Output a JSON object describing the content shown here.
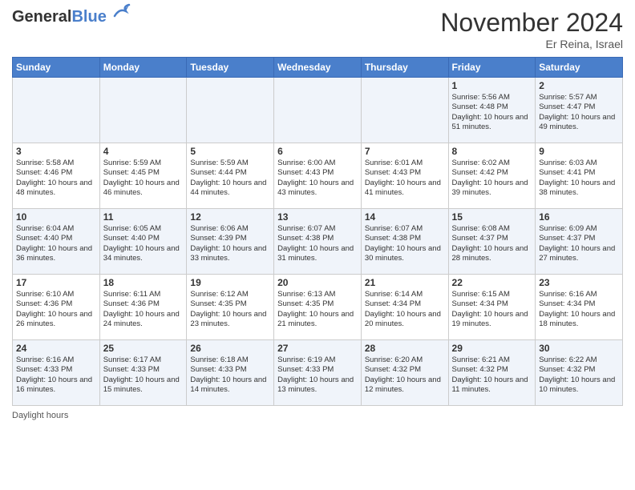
{
  "logo": {
    "general": "General",
    "blue": "Blue"
  },
  "header": {
    "month": "November 2024",
    "location": "Er Reina, Israel"
  },
  "days_of_week": [
    "Sunday",
    "Monday",
    "Tuesday",
    "Wednesday",
    "Thursday",
    "Friday",
    "Saturday"
  ],
  "weeks": [
    [
      {
        "day": "",
        "info": ""
      },
      {
        "day": "",
        "info": ""
      },
      {
        "day": "",
        "info": ""
      },
      {
        "day": "",
        "info": ""
      },
      {
        "day": "",
        "info": ""
      },
      {
        "day": "1",
        "info": "Sunrise: 5:56 AM\nSunset: 4:48 PM\nDaylight: 10 hours and 51 minutes."
      },
      {
        "day": "2",
        "info": "Sunrise: 5:57 AM\nSunset: 4:47 PM\nDaylight: 10 hours and 49 minutes."
      }
    ],
    [
      {
        "day": "3",
        "info": "Sunrise: 5:58 AM\nSunset: 4:46 PM\nDaylight: 10 hours and 48 minutes."
      },
      {
        "day": "4",
        "info": "Sunrise: 5:59 AM\nSunset: 4:45 PM\nDaylight: 10 hours and 46 minutes."
      },
      {
        "day": "5",
        "info": "Sunrise: 5:59 AM\nSunset: 4:44 PM\nDaylight: 10 hours and 44 minutes."
      },
      {
        "day": "6",
        "info": "Sunrise: 6:00 AM\nSunset: 4:43 PM\nDaylight: 10 hours and 43 minutes."
      },
      {
        "day": "7",
        "info": "Sunrise: 6:01 AM\nSunset: 4:43 PM\nDaylight: 10 hours and 41 minutes."
      },
      {
        "day": "8",
        "info": "Sunrise: 6:02 AM\nSunset: 4:42 PM\nDaylight: 10 hours and 39 minutes."
      },
      {
        "day": "9",
        "info": "Sunrise: 6:03 AM\nSunset: 4:41 PM\nDaylight: 10 hours and 38 minutes."
      }
    ],
    [
      {
        "day": "10",
        "info": "Sunrise: 6:04 AM\nSunset: 4:40 PM\nDaylight: 10 hours and 36 minutes."
      },
      {
        "day": "11",
        "info": "Sunrise: 6:05 AM\nSunset: 4:40 PM\nDaylight: 10 hours and 34 minutes."
      },
      {
        "day": "12",
        "info": "Sunrise: 6:06 AM\nSunset: 4:39 PM\nDaylight: 10 hours and 33 minutes."
      },
      {
        "day": "13",
        "info": "Sunrise: 6:07 AM\nSunset: 4:38 PM\nDaylight: 10 hours and 31 minutes."
      },
      {
        "day": "14",
        "info": "Sunrise: 6:07 AM\nSunset: 4:38 PM\nDaylight: 10 hours and 30 minutes."
      },
      {
        "day": "15",
        "info": "Sunrise: 6:08 AM\nSunset: 4:37 PM\nDaylight: 10 hours and 28 minutes."
      },
      {
        "day": "16",
        "info": "Sunrise: 6:09 AM\nSunset: 4:37 PM\nDaylight: 10 hours and 27 minutes."
      }
    ],
    [
      {
        "day": "17",
        "info": "Sunrise: 6:10 AM\nSunset: 4:36 PM\nDaylight: 10 hours and 26 minutes."
      },
      {
        "day": "18",
        "info": "Sunrise: 6:11 AM\nSunset: 4:36 PM\nDaylight: 10 hours and 24 minutes."
      },
      {
        "day": "19",
        "info": "Sunrise: 6:12 AM\nSunset: 4:35 PM\nDaylight: 10 hours and 23 minutes."
      },
      {
        "day": "20",
        "info": "Sunrise: 6:13 AM\nSunset: 4:35 PM\nDaylight: 10 hours and 21 minutes."
      },
      {
        "day": "21",
        "info": "Sunrise: 6:14 AM\nSunset: 4:34 PM\nDaylight: 10 hours and 20 minutes."
      },
      {
        "day": "22",
        "info": "Sunrise: 6:15 AM\nSunset: 4:34 PM\nDaylight: 10 hours and 19 minutes."
      },
      {
        "day": "23",
        "info": "Sunrise: 6:16 AM\nSunset: 4:34 PM\nDaylight: 10 hours and 18 minutes."
      }
    ],
    [
      {
        "day": "24",
        "info": "Sunrise: 6:16 AM\nSunset: 4:33 PM\nDaylight: 10 hours and 16 minutes."
      },
      {
        "day": "25",
        "info": "Sunrise: 6:17 AM\nSunset: 4:33 PM\nDaylight: 10 hours and 15 minutes."
      },
      {
        "day": "26",
        "info": "Sunrise: 6:18 AM\nSunset: 4:33 PM\nDaylight: 10 hours and 14 minutes."
      },
      {
        "day": "27",
        "info": "Sunrise: 6:19 AM\nSunset: 4:33 PM\nDaylight: 10 hours and 13 minutes."
      },
      {
        "day": "28",
        "info": "Sunrise: 6:20 AM\nSunset: 4:32 PM\nDaylight: 10 hours and 12 minutes."
      },
      {
        "day": "29",
        "info": "Sunrise: 6:21 AM\nSunset: 4:32 PM\nDaylight: 10 hours and 11 minutes."
      },
      {
        "day": "30",
        "info": "Sunrise: 6:22 AM\nSunset: 4:32 PM\nDaylight: 10 hours and 10 minutes."
      }
    ]
  ],
  "legend": {
    "daylight_label": "Daylight hours"
  }
}
